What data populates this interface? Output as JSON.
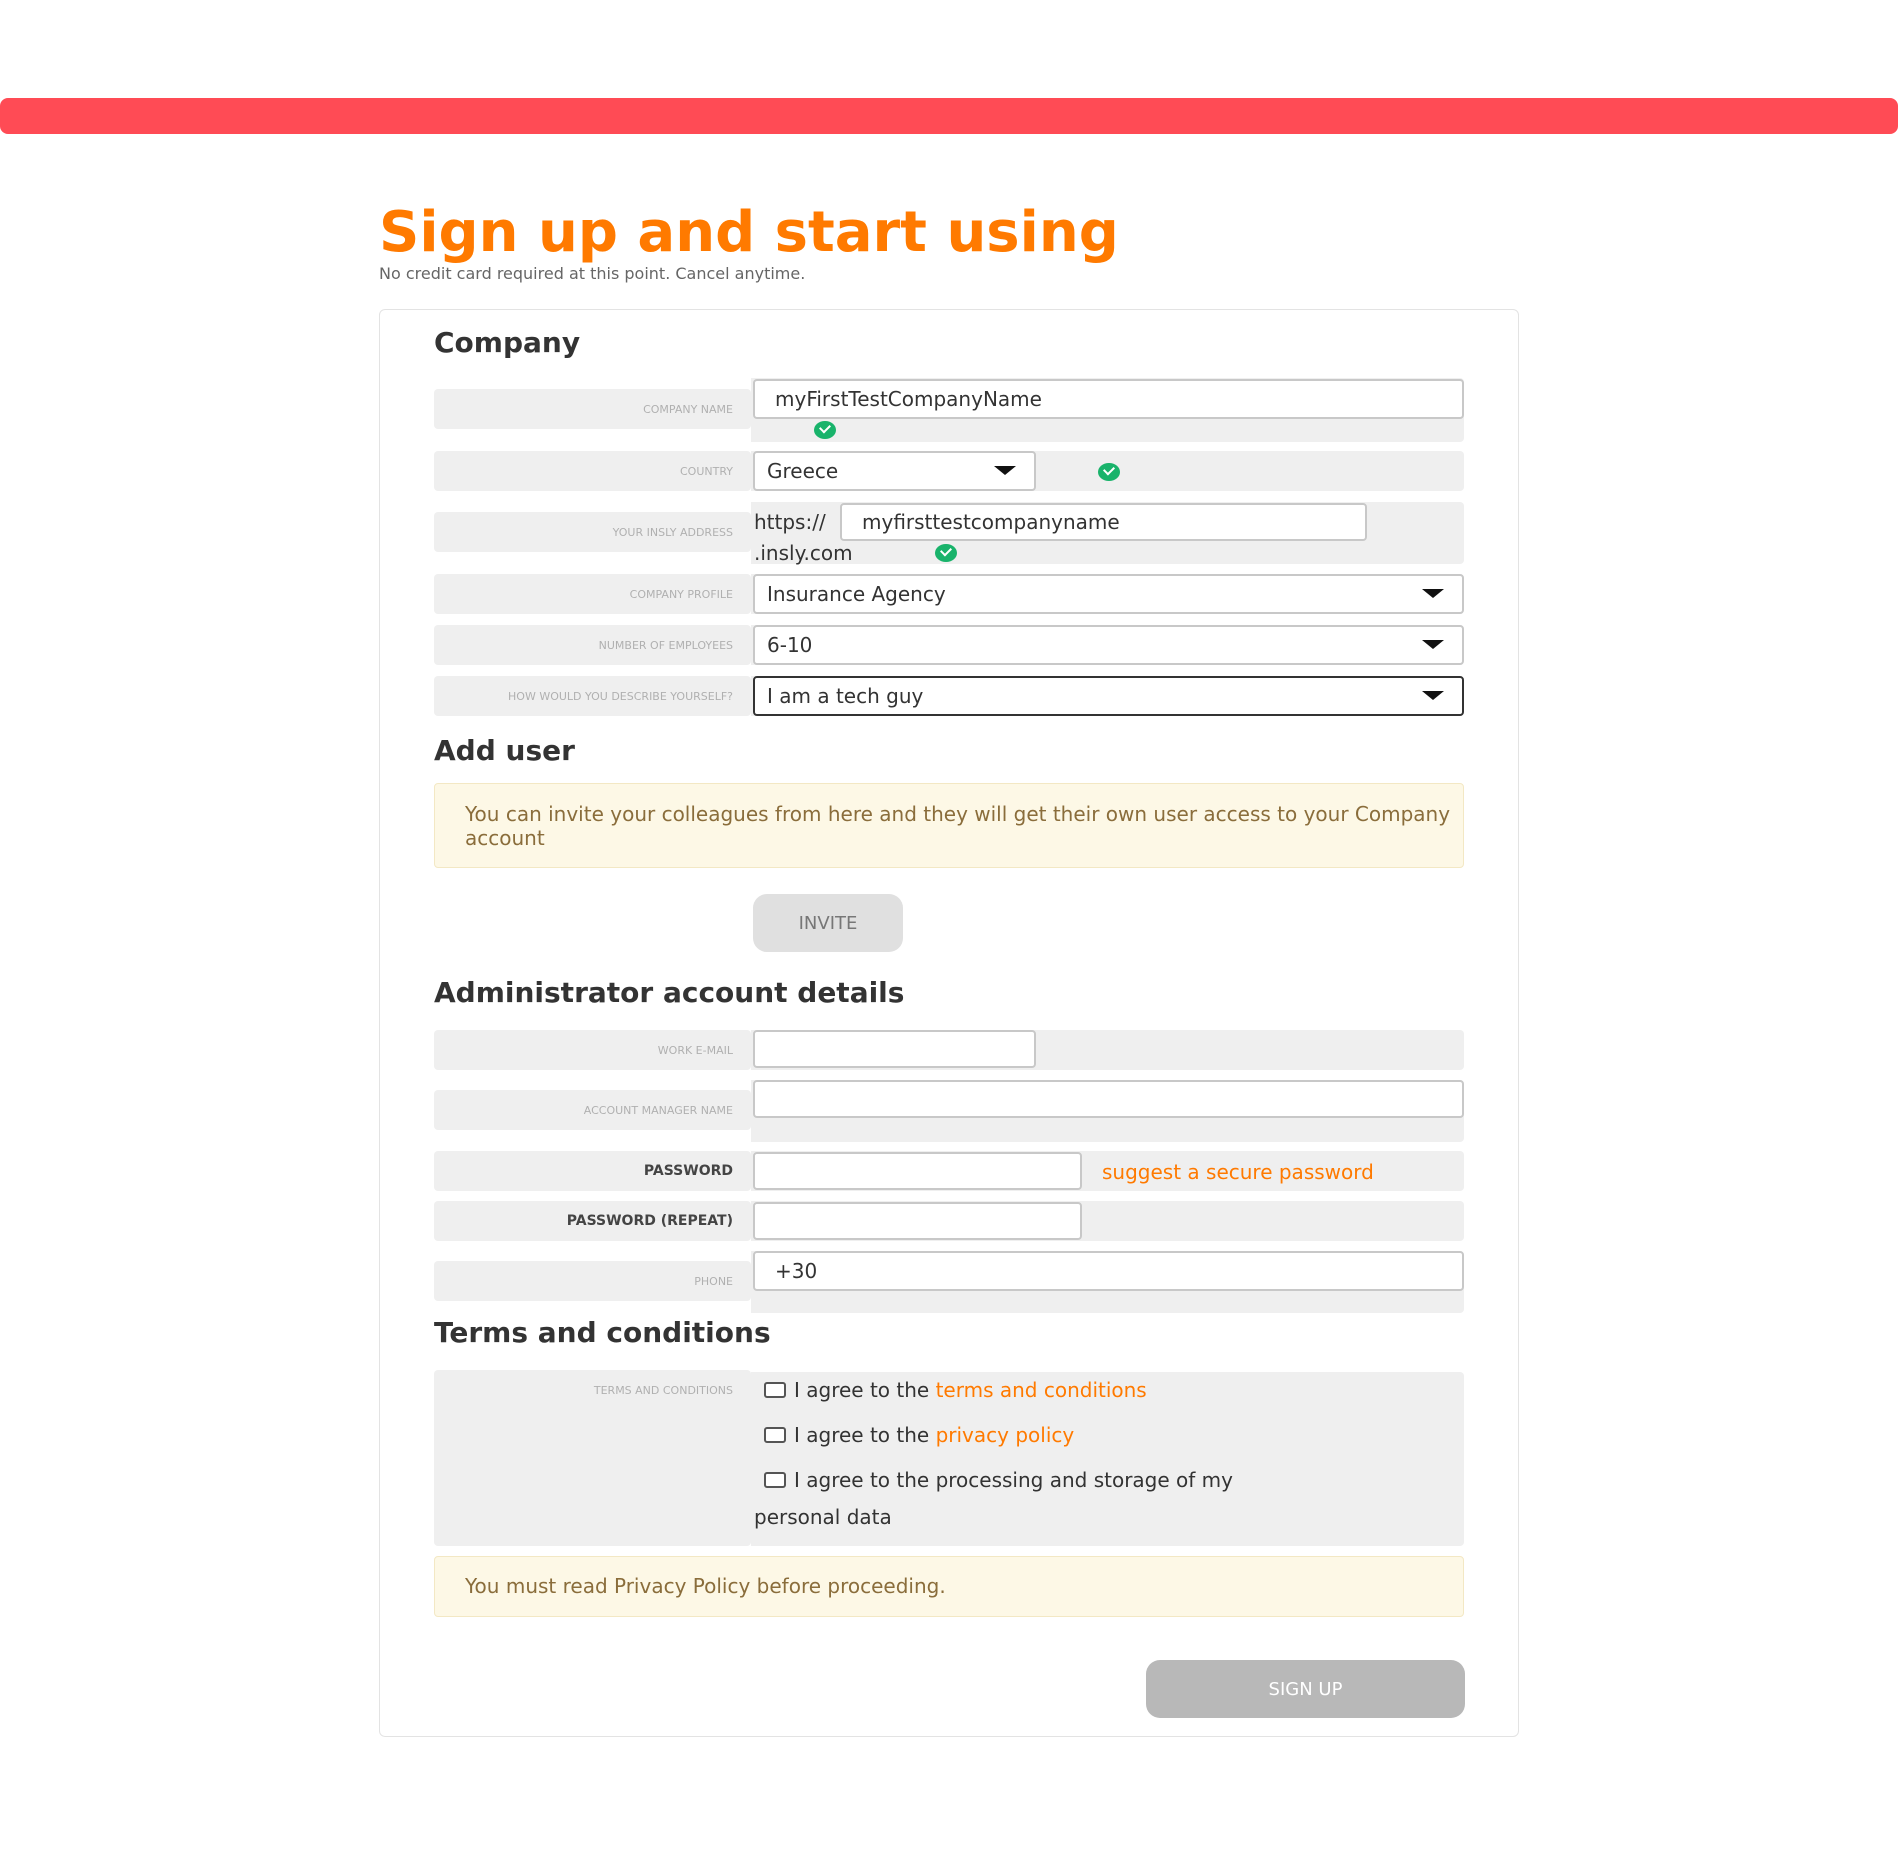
{
  "header": {
    "title": "Sign up and start using",
    "subtitle": "No credit card required at this point. Cancel anytime."
  },
  "company": {
    "section_title": "Company",
    "company_name": {
      "label": "COMPANY NAME",
      "value": "myFirstTestCompanyName"
    },
    "country": {
      "label": "COUNTRY",
      "value": "Greece"
    },
    "insly_address": {
      "label": "YOUR INSLY ADDRESS",
      "prefix": "https://",
      "value": "myfirsttestcompanyname",
      "suffix": ".insly.com"
    },
    "company_profile": {
      "label": "COMPANY PROFILE",
      "value": "Insurance Agency"
    },
    "employees": {
      "label": "NUMBER OF EMPLOYEES",
      "value": "6-10"
    },
    "describe": {
      "label": "HOW WOULD YOU DESCRIBE YOURSELF?",
      "value": "I am a tech guy"
    }
  },
  "add_user": {
    "section_title": "Add user",
    "notice": "You can invite your colleagues from here and they will get their own user access to your Company account",
    "invite_label": "INVITE"
  },
  "admin": {
    "section_title": "Administrator account details",
    "work_email": {
      "label": "WORK E-MAIL",
      "value": ""
    },
    "manager_name": {
      "label": "ACCOUNT MANAGER NAME",
      "value": ""
    },
    "password": {
      "label": "PASSWORD",
      "value": "",
      "suggest_link": "suggest a secure password"
    },
    "password_repeat": {
      "label": "PASSWORD (REPEAT)",
      "value": ""
    },
    "phone": {
      "label": "PHONE",
      "value": "+30"
    }
  },
  "terms": {
    "section_title": "Terms and conditions",
    "label": "TERMS AND CONDITIONS",
    "agree_prefix": "I agree to the",
    "terms_link": "terms and conditions",
    "privacy_link": "privacy policy",
    "processing_line1": "I agree to the processing and storage of my",
    "processing_line2": "personal data",
    "notice": "You must read Privacy Policy before proceeding."
  },
  "signup_label": "SIGN UP",
  "colors": {
    "accent": "#ff7a00",
    "topbar": "#ff4b55",
    "success": "#19b36b"
  },
  "icons": {
    "validation": "check-circle-icon",
    "dropdown": "chevron-down-icon"
  }
}
